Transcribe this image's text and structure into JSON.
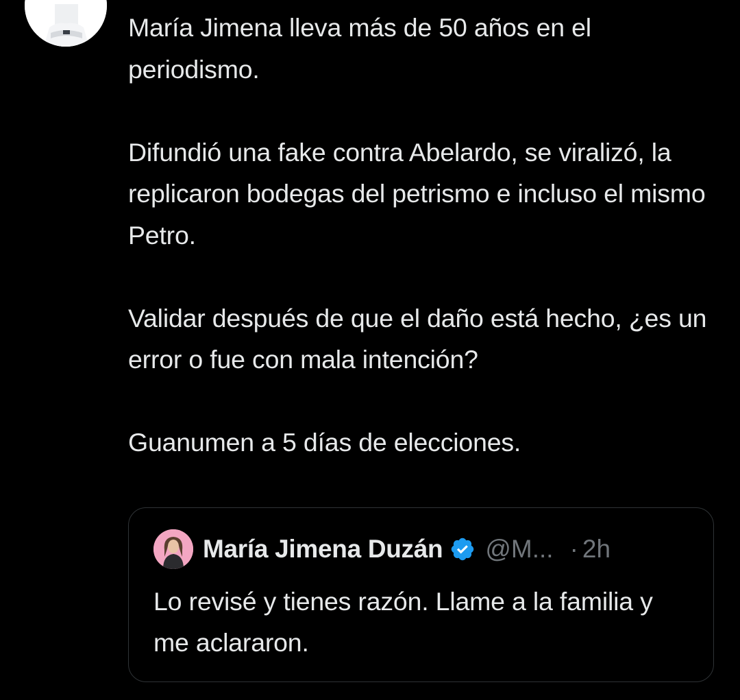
{
  "tweet": {
    "paragraphs": [
      "María Jimena lleva más de 50 años en el periodismo.",
      "Difundió una fake contra Abelardo, se viralizó, la replicaron bodegas del petrismo e incluso el mismo Petro.",
      "Validar después de que el daño está hecho, ¿es un error o fue con mala intención?",
      "Guanumen a 5 días de elecciones."
    ]
  },
  "quote": {
    "author_name": "María Jimena Duzán",
    "handle": "@M...",
    "separator": "·",
    "time": "2h",
    "verified_icon": "verified-badge-icon",
    "text": "Lo revisé y tienes razón. Llame a la familia y me aclararon."
  },
  "colors": {
    "background": "#000000",
    "text_primary": "#e7e9ea",
    "text_secondary": "#71767b",
    "border": "#2f3336",
    "verified_blue": "#1d9bf0"
  }
}
